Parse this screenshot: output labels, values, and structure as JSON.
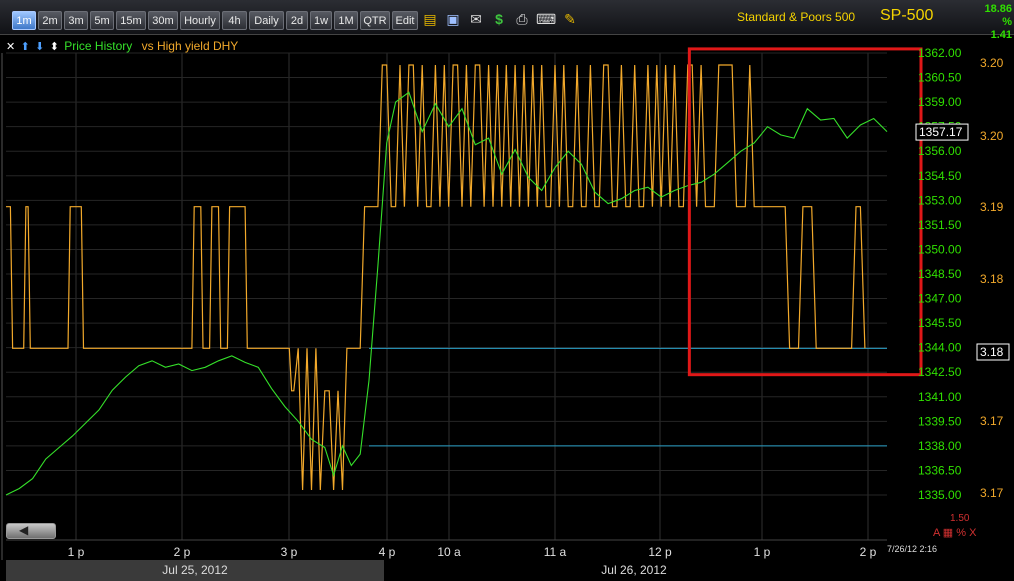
{
  "toolbar": {
    "timeframes": [
      "1m",
      "2m",
      "3m",
      "5m",
      "15m",
      "30m",
      "Hourly",
      "4h",
      "Daily",
      "2d",
      "1w",
      "1M",
      "QTR",
      "Edit"
    ],
    "active_timeframe": "1m",
    "icons": [
      "lock-icon",
      "save-icon",
      "email-icon",
      "dollar-icon",
      "print-icon",
      "keyboard-icon",
      "pencil-icon"
    ]
  },
  "header": {
    "symbol_description": "Standard & Poors 500",
    "symbol": "SP-500",
    "quote_value": "18.86",
    "quote_percent": "% 1.41"
  },
  "legend": {
    "controls": [
      "✕",
      "⬆",
      "⬇",
      "⬍"
    ],
    "price_label": "Price History",
    "comparison_label": "vs High yield DHY"
  },
  "colors": {
    "price": "#35e02a",
    "comparison": "#f2a92b",
    "reference_line": "#2aa0c8",
    "highlight_box": "#e01818",
    "axis_text_left": "#30e000",
    "axis_text_right": "#f2a92b"
  },
  "chart_data": {
    "type": "line",
    "x_tick_labels": [
      "1 p",
      "2 p",
      "3 p",
      "4 p",
      "10 a",
      "11 a",
      "12 p",
      "1 p",
      "2 p"
    ],
    "date_labels": [
      "Jul 25, 2012",
      "Jul 26, 2012"
    ],
    "timestamp": "7/26/12 2:16",
    "y_left": {
      "ticks": [
        "1362.00",
        "1360.50",
        "1359.00",
        "1357.50",
        "1356.00",
        "1354.50",
        "1353.00",
        "1351.50",
        "1350.00",
        "1348.50",
        "1347.00",
        "1345.50",
        "1344.00",
        "1342.50",
        "1341.00",
        "1339.50",
        "1338.00",
        "1336.50",
        "1335.00"
      ],
      "range": [
        1335.0,
        1362.0
      ],
      "last_value": "1357.17"
    },
    "y_right": {
      "ticks": [
        "3.20",
        "3.20",
        "3.19",
        "3.18",
        "3.18",
        "3.17",
        "3.17"
      ],
      "range": [
        3.17,
        3.2
      ],
      "last_value": "3.18"
    },
    "series": [
      {
        "name": "Price History",
        "axis": "left",
        "points": [
          [
            0,
            1335.0
          ],
          [
            3,
            1335.4
          ],
          [
            6,
            1336.0
          ],
          [
            9,
            1337.2
          ],
          [
            12,
            1337.9
          ],
          [
            15,
            1338.6
          ],
          [
            18,
            1339.4
          ],
          [
            21,
            1340.2
          ],
          [
            24,
            1341.4
          ],
          [
            27,
            1342.2
          ],
          [
            30,
            1342.9
          ],
          [
            33,
            1343.2
          ],
          [
            36,
            1342.8
          ],
          [
            39,
            1343.0
          ],
          [
            42,
            1342.6
          ],
          [
            45,
            1342.8
          ],
          [
            48,
            1343.2
          ],
          [
            51,
            1343.5
          ],
          [
            54,
            1343.1
          ],
          [
            57,
            1342.8
          ],
          [
            60,
            1341.5
          ],
          [
            63,
            1340.4
          ],
          [
            66,
            1339.5
          ],
          [
            69,
            1338.4
          ],
          [
            72,
            1337.9
          ],
          [
            74,
            1336.2
          ],
          [
            76,
            1338.0
          ],
          [
            78,
            1336.8
          ],
          [
            80,
            1337.5
          ],
          [
            82,
            1342.0
          ],
          [
            84,
            1349.0
          ],
          [
            86,
            1356.5
          ],
          [
            88,
            1359.0
          ],
          [
            91,
            1359.6
          ],
          [
            94,
            1357.2
          ],
          [
            97,
            1358.9
          ],
          [
            100,
            1357.5
          ],
          [
            103,
            1358.6
          ],
          [
            106,
            1356.4
          ],
          [
            109,
            1356.8
          ],
          [
            112,
            1354.6
          ],
          [
            115,
            1356.1
          ],
          [
            118,
            1354.4
          ],
          [
            121,
            1353.6
          ],
          [
            124,
            1355.0
          ],
          [
            127,
            1356.0
          ],
          [
            130,
            1355.2
          ],
          [
            133,
            1353.5
          ],
          [
            136,
            1352.8
          ],
          [
            139,
            1353.1
          ],
          [
            142,
            1353.6
          ],
          [
            145,
            1353.8
          ],
          [
            148,
            1353.2
          ],
          [
            151,
            1353.6
          ],
          [
            154,
            1353.9
          ],
          [
            157,
            1354.1
          ],
          [
            160,
            1354.6
          ],
          [
            163,
            1355.3
          ],
          [
            166,
            1356.0
          ],
          [
            169,
            1356.5
          ],
          [
            172,
            1357.5
          ],
          [
            175,
            1357.0
          ],
          [
            178,
            1356.8
          ],
          [
            181,
            1358.6
          ],
          [
            184,
            1357.9
          ],
          [
            187,
            1358.0
          ],
          [
            190,
            1356.8
          ],
          [
            193,
            1357.6
          ],
          [
            196,
            1358.0
          ],
          [
            199,
            1357.2
          ]
        ]
      },
      {
        "name": "vs High yield DHY",
        "axis": "right",
        "points": [
          [
            0,
            3.19
          ],
          [
            1,
            3.19
          ],
          [
            1.5,
            3.18
          ],
          [
            4,
            3.18
          ],
          [
            4.5,
            3.19
          ],
          [
            5,
            3.19
          ],
          [
            5.5,
            3.18
          ],
          [
            14,
            3.18
          ],
          [
            14.5,
            3.19
          ],
          [
            17,
            3.19
          ],
          [
            17.5,
            3.18
          ],
          [
            42,
            3.18
          ],
          [
            42.5,
            3.19
          ],
          [
            44,
            3.19
          ],
          [
            44.5,
            3.18
          ],
          [
            46,
            3.18
          ],
          [
            46.5,
            3.19
          ],
          [
            48,
            3.19
          ],
          [
            48.5,
            3.18
          ],
          [
            50,
            3.18
          ],
          [
            50.5,
            3.19
          ],
          [
            54,
            3.19
          ],
          [
            54.5,
            3.18
          ],
          [
            58,
            3.18
          ],
          [
            58.5,
            3.18
          ],
          [
            64,
            3.18
          ],
          [
            64.5,
            3.177
          ],
          [
            65,
            3.177
          ],
          [
            66,
            3.18
          ],
          [
            67,
            3.17
          ],
          [
            68,
            3.18
          ],
          [
            69,
            3.17
          ],
          [
            70,
            3.18
          ],
          [
            71,
            3.17
          ],
          [
            72,
            3.177
          ],
          [
            73,
            3.177
          ],
          [
            74,
            3.17
          ],
          [
            75,
            3.177
          ],
          [
            76,
            3.17
          ],
          [
            77,
            3.18
          ],
          [
            80,
            3.18
          ],
          [
            81,
            3.19
          ],
          [
            84,
            3.19
          ],
          [
            85,
            3.2
          ],
          [
            86,
            3.2
          ],
          [
            87,
            3.19
          ],
          [
            88,
            3.19
          ],
          [
            89,
            3.2
          ],
          [
            90,
            3.19
          ],
          [
            91,
            3.2
          ],
          [
            92,
            3.2
          ],
          [
            93,
            3.19
          ],
          [
            94,
            3.2
          ],
          [
            95,
            3.19
          ],
          [
            96,
            3.19
          ],
          [
            97,
            3.2
          ],
          [
            98,
            3.19
          ],
          [
            99,
            3.2
          ],
          [
            100,
            3.19
          ],
          [
            101,
            3.2
          ],
          [
            102,
            3.2
          ],
          [
            103,
            3.19
          ],
          [
            104,
            3.2
          ],
          [
            105,
            3.19
          ],
          [
            106,
            3.2
          ],
          [
            107,
            3.2
          ],
          [
            108,
            3.19
          ],
          [
            109,
            3.2
          ],
          [
            110,
            3.19
          ],
          [
            111,
            3.2
          ],
          [
            112,
            3.19
          ],
          [
            113,
            3.2
          ],
          [
            114,
            3.19
          ],
          [
            115,
            3.2
          ],
          [
            116,
            3.19
          ],
          [
            117,
            3.2
          ],
          [
            118,
            3.19
          ],
          [
            119,
            3.2
          ],
          [
            120,
            3.19
          ],
          [
            121,
            3.2
          ],
          [
            122,
            3.19
          ],
          [
            123,
            3.19
          ],
          [
            124,
            3.2
          ],
          [
            125,
            3.19
          ],
          [
            126,
            3.2
          ],
          [
            127,
            3.19
          ],
          [
            128,
            3.19
          ],
          [
            129,
            3.2
          ],
          [
            130,
            3.19
          ],
          [
            131,
            3.19
          ],
          [
            132,
            3.2
          ],
          [
            133,
            3.19
          ],
          [
            134,
            3.19
          ],
          [
            135,
            3.2
          ],
          [
            136,
            3.2
          ],
          [
            137,
            3.19
          ],
          [
            138,
            3.19
          ],
          [
            139,
            3.2
          ],
          [
            140,
            3.19
          ],
          [
            141,
            3.19
          ],
          [
            142,
            3.2
          ],
          [
            143,
            3.19
          ],
          [
            144,
            3.19
          ],
          [
            145,
            3.2
          ],
          [
            146,
            3.19
          ],
          [
            147,
            3.2
          ],
          [
            148,
            3.19
          ],
          [
            149,
            3.2
          ],
          [
            150,
            3.19
          ],
          [
            151,
            3.2
          ],
          [
            152,
            3.19
          ],
          [
            153,
            3.19
          ],
          [
            154,
            3.2
          ],
          [
            155,
            3.2
          ],
          [
            156,
            3.19
          ],
          [
            157,
            3.2
          ],
          [
            158,
            3.19
          ],
          [
            160,
            3.19
          ],
          [
            161,
            3.2
          ],
          [
            164,
            3.2
          ],
          [
            165,
            3.19
          ],
          [
            167,
            3.19
          ],
          [
            168,
            3.2
          ],
          [
            169,
            3.19
          ],
          [
            171,
            3.19
          ],
          [
            176,
            3.19
          ],
          [
            177,
            3.18
          ],
          [
            179,
            3.18
          ],
          [
            180,
            3.19
          ],
          [
            182,
            3.19
          ],
          [
            183,
            3.18
          ],
          [
            191,
            3.18
          ],
          [
            192,
            3.19
          ],
          [
            193,
            3.19
          ],
          [
            194,
            3.18
          ]
        ]
      },
      {
        "name": "",
        "axis": "right",
        "points": [
          [
            82,
            3.18
          ],
          [
            199,
            3.18
          ]
        ]
      },
      {
        "name": "",
        "axis": "left",
        "points": [
          [
            82,
            1338.0
          ],
          [
            199,
            1338.0
          ]
        ]
      }
    ],
    "annotations": [
      {
        "type": "rectangle",
        "x_range": [
          153,
          199
        ],
        "y_range_left": [
          1342.35,
          1362.25
        ]
      }
    ],
    "grid": true
  },
  "bottom": {
    "corner_value": "1.50",
    "corner_controls": "A ▦ % X"
  }
}
